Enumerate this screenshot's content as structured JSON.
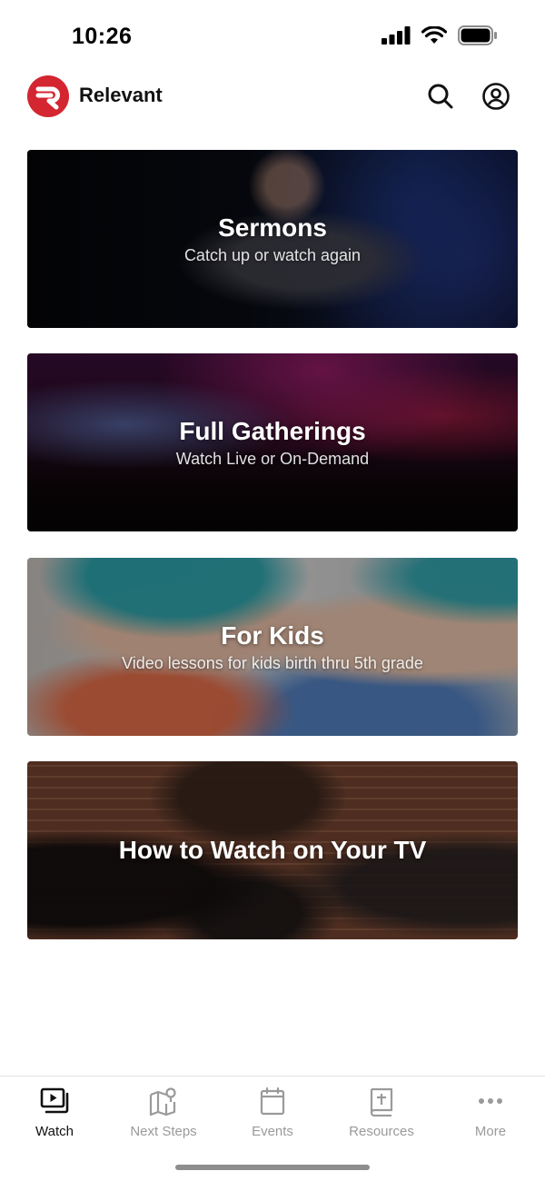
{
  "status_bar": {
    "time": "10:26",
    "icons": [
      "cellular-signal-icon",
      "wifi-icon",
      "battery-icon"
    ]
  },
  "header": {
    "app_name": "Relevant",
    "logo_letter": "R",
    "logo_color": "#d32630",
    "actions": [
      "search-icon",
      "profile-icon"
    ]
  },
  "cards": [
    {
      "title": "Sermons",
      "subtitle": "Catch up or watch again"
    },
    {
      "title": "Full Gatherings",
      "subtitle": "Watch Live or On-Demand"
    },
    {
      "title": "For Kids",
      "subtitle": "Video lessons for kids birth thru 5th grade"
    },
    {
      "title": "How to Watch on Your TV",
      "subtitle": ""
    }
  ],
  "tab_bar": {
    "active_index": 0,
    "tabs": [
      {
        "label": "Watch",
        "icon": "play-video-icon"
      },
      {
        "label": "Next Steps",
        "icon": "map-pin-icon"
      },
      {
        "label": "Events",
        "icon": "calendar-icon"
      },
      {
        "label": "Resources",
        "icon": "bible-icon"
      },
      {
        "label": "More",
        "icon": "more-dots-icon"
      }
    ]
  },
  "colors": {
    "active_tab": "#111111",
    "inactive_tab": "#9a9a9a"
  }
}
